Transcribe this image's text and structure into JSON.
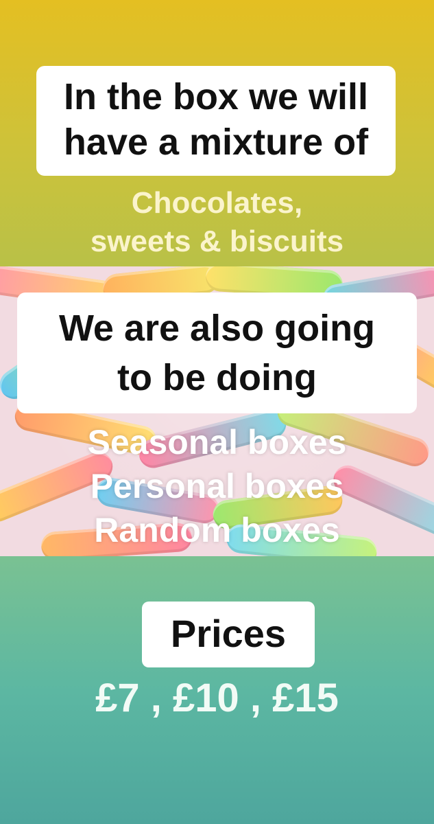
{
  "intro_heading": "In the box we will\nhave a mixture of",
  "mixture_items": "Chocolates,\nsweets & biscuits",
  "also_heading": "We are also going\nto be doing",
  "box_types": "Seasonal boxes\nPersonal boxes\nRandom boxes",
  "prices_heading": "Prices",
  "prices_values": "£7 , £10 , £15",
  "background_image": "sour gummy worms sweets",
  "colors": {
    "top": "#e4bf22",
    "bottom": "#4ea69d",
    "label_bg": "#ffffff",
    "label_text": "#111111",
    "overlay_text": "#ffffff"
  }
}
